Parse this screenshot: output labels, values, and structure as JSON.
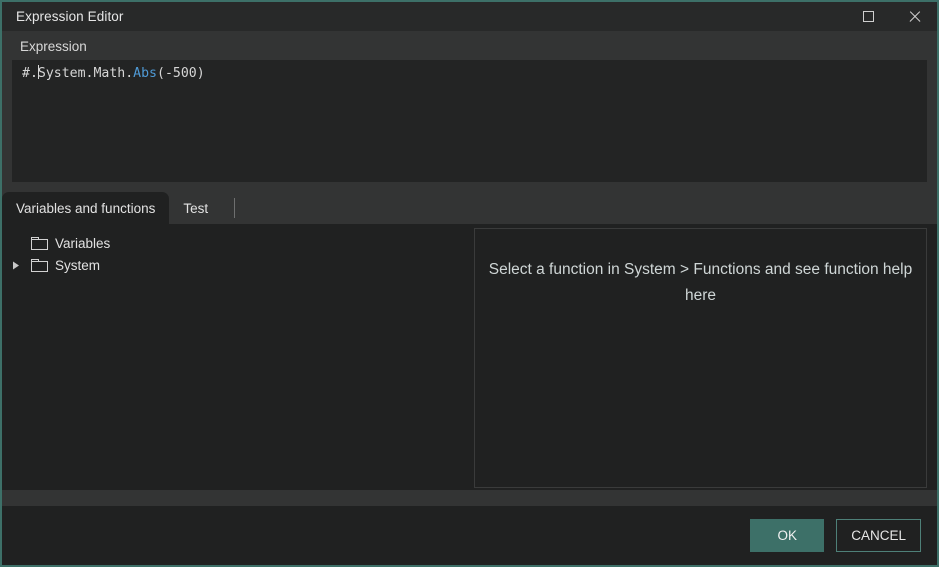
{
  "window": {
    "title": "Expression Editor",
    "accent_color": "#3d7068",
    "controls": {
      "maximize_icon": "maximize-square-icon",
      "close_icon": "close-x-icon"
    }
  },
  "expression": {
    "label": "Expression",
    "code_prefix": "#.",
    "code_middle": "System.Math.",
    "code_function": "Abs",
    "code_suffix": "(-500)",
    "full_text": "#.System.Math.Abs(-500)"
  },
  "tabs": [
    {
      "label": "Variables and functions",
      "active": true
    },
    {
      "label": "Test",
      "active": false
    }
  ],
  "tree": [
    {
      "label": "Variables",
      "icon": "folder-icon",
      "expandable": false,
      "expanded": false,
      "indent": 1
    },
    {
      "label": "System",
      "icon": "folder-icon",
      "expandable": true,
      "expanded": false,
      "indent": 0
    }
  ],
  "help_panel": {
    "message": "Select a function in System > Functions and see function help here"
  },
  "footer": {
    "ok_label": "OK",
    "cancel_label": "CANCEL",
    "ok_color": "#3d7068",
    "cancel_border_color": "#4e8078"
  }
}
